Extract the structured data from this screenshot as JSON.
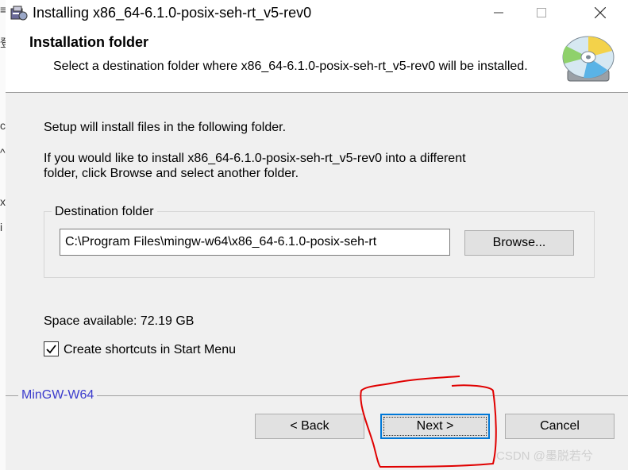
{
  "window": {
    "title": "Installing x86_64-6.1.0-posix-seh-rt_v5-rev0",
    "controls": {
      "minimize": "minimize",
      "maximize": "maximize",
      "close": "close"
    }
  },
  "header": {
    "title": "Installation folder",
    "subtitle": "Select a destination folder where x86_64-6.1.0-posix-seh-rt_v5-rev0 will be installed."
  },
  "body": {
    "intro": "Setup will install files in the following folder.",
    "instructions_line1": "If you would like to install x86_64-6.1.0-posix-seh-rt_v5-rev0 into a different",
    "instructions_line2": "folder, click Browse and select another folder.",
    "destination_group_label": "Destination folder",
    "destination_path": "C:\\Program Files\\mingw-w64\\x86_64-6.1.0-posix-seh-rt",
    "browse_label": "Browse...",
    "space_available": "Space available: 72.19 GB",
    "shortcuts_label": "Create shortcuts in Start Menu",
    "shortcuts_checked": true
  },
  "footer": {
    "brand": "MinGW-W64",
    "back_label": "< Back",
    "next_label": "Next >",
    "cancel_label": "Cancel"
  },
  "background_app": {
    "glyphs": [
      "≡",
      "登",
      "c",
      "^",
      "x",
      "i"
    ]
  },
  "watermark": "CSDN @墨脱若兮",
  "colors": {
    "annotation": "#e00000",
    "brand": "#3b3bcc",
    "focus": "#0078d7"
  }
}
